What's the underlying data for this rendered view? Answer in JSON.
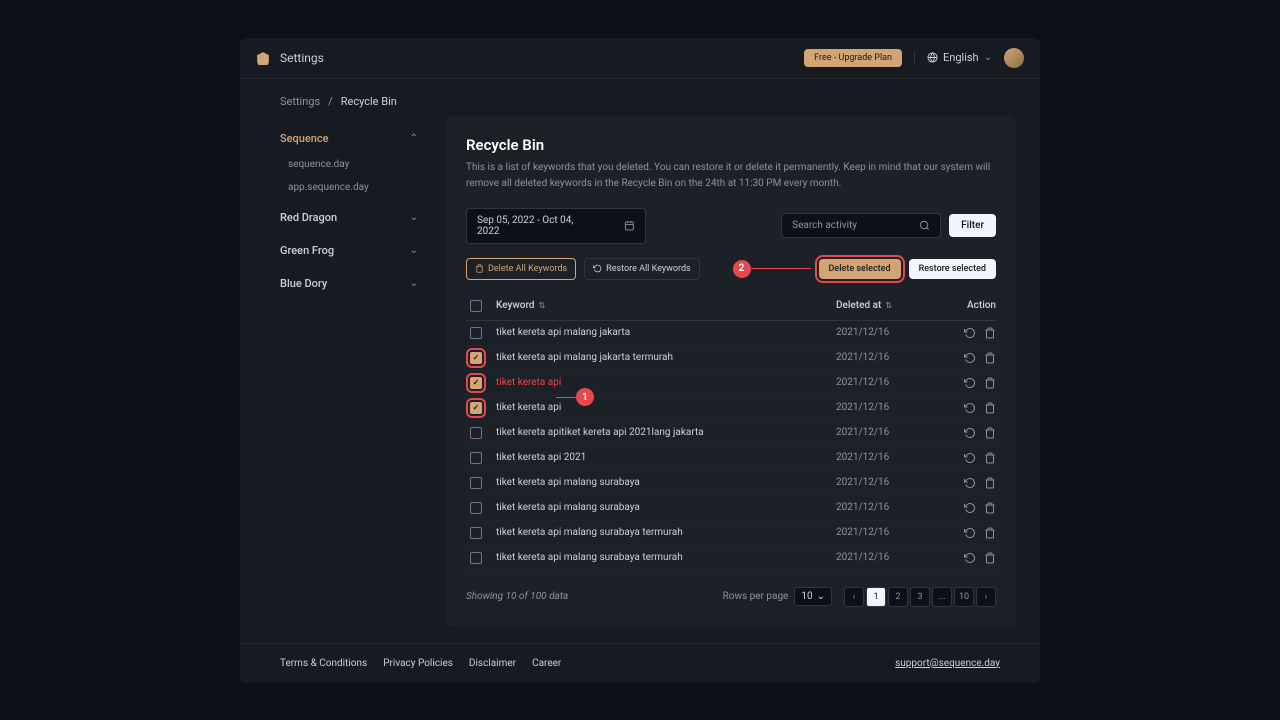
{
  "topbar": {
    "title": "Settings",
    "upgrade": "Free - Upgrade Plan",
    "language": "English"
  },
  "breadcrumb": {
    "parent": "Settings",
    "sep": "/",
    "current": "Recycle Bin"
  },
  "sidebar": {
    "groups": [
      {
        "label": "Sequence",
        "expanded": true,
        "children": [
          "sequence.day",
          "app.sequence.day"
        ]
      },
      {
        "label": "Red Dragon",
        "expanded": false
      },
      {
        "label": "Green Frog",
        "expanded": false
      },
      {
        "label": "Blue Dory",
        "expanded": false
      }
    ]
  },
  "page": {
    "title": "Recycle Bin",
    "desc": "This is a list of keywords that you deleted. You can restore it or delete it permanently. Keep in mind that our system will remove all deleted keywords in the Recycle Bin on the 24th at 11:30 PM every month."
  },
  "controls": {
    "date_range": "Sep 05, 2022 - Oct 04, 2022",
    "search_placeholder": "Search activity",
    "filter": "Filter"
  },
  "actions": {
    "delete_all": "Delete All Keywords",
    "restore_all": "Restore All Keywords",
    "delete_selected": "Delete selected",
    "restore_selected": "Restore selected"
  },
  "callouts": {
    "c1": "1",
    "c2": "2"
  },
  "table": {
    "headers": {
      "keyword": "Keyword",
      "deleted_at": "Deleted at",
      "action": "Action"
    },
    "rows": [
      {
        "checked": false,
        "keyword": "tiket kereta api malang jakarta",
        "date": "2021/12/16"
      },
      {
        "checked": true,
        "keyword": "tiket kereta api malang jakarta termurah",
        "date": "2021/12/16"
      },
      {
        "checked": true,
        "keyword": "tiket kereta api",
        "date": "2021/12/16",
        "highlighted": true
      },
      {
        "checked": true,
        "keyword": "tiket kereta api",
        "date": "2021/12/16"
      },
      {
        "checked": false,
        "keyword": "tiket kereta apitiket kereta api 2021lang jakarta",
        "date": "2021/12/16"
      },
      {
        "checked": false,
        "keyword": "tiket kereta api 2021",
        "date": "2021/12/16"
      },
      {
        "checked": false,
        "keyword": "tiket kereta api malang surabaya",
        "date": "2021/12/16"
      },
      {
        "checked": false,
        "keyword": "tiket kereta api malang surabaya",
        "date": "2021/12/16"
      },
      {
        "checked": false,
        "keyword": "tiket kereta api malang surabaya termurah",
        "date": "2021/12/16"
      },
      {
        "checked": false,
        "keyword": "tiket kereta api malang surabaya termurah",
        "date": "2021/12/16"
      }
    ]
  },
  "pagination": {
    "showing": "Showing 10 of 100 data",
    "rows_label": "Rows per page",
    "rows_value": "10",
    "pages": [
      "1",
      "2",
      "3",
      "...",
      "10"
    ]
  },
  "footer": {
    "links": [
      "Terms & Conditions",
      "Privacy Policies",
      "Disclaimer",
      "Career"
    ],
    "email": "support@sequence.day"
  }
}
